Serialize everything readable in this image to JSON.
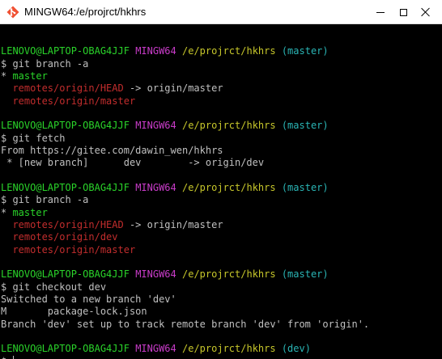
{
  "window": {
    "title": "MINGW64:/e/projrct/hkhrs"
  },
  "terminal": {
    "lines": [
      [],
      [
        {
          "t": "LENOVO@LAPTOP-OBAG4JJF",
          "c": "green"
        },
        {
          "t": " ",
          "c": "white"
        },
        {
          "t": "MINGW64",
          "c": "magenta"
        },
        {
          "t": " ",
          "c": "white"
        },
        {
          "t": "/e/projrct/hkhrs",
          "c": "yellow"
        },
        {
          "t": " ",
          "c": "white"
        },
        {
          "t": "(master)",
          "c": "cyan"
        }
      ],
      [
        {
          "t": "$ git branch -a",
          "c": "white"
        }
      ],
      [
        {
          "t": "* ",
          "c": "white"
        },
        {
          "t": "master",
          "c": "green"
        }
      ],
      [
        {
          "t": "  ",
          "c": "white"
        },
        {
          "t": "remotes/origin/HEAD",
          "c": "red"
        },
        {
          "t": " -> origin/master",
          "c": "white"
        }
      ],
      [
        {
          "t": "  ",
          "c": "white"
        },
        {
          "t": "remotes/origin/master",
          "c": "red"
        }
      ],
      [],
      [
        {
          "t": "LENOVO@LAPTOP-OBAG4JJF",
          "c": "green"
        },
        {
          "t": " ",
          "c": "white"
        },
        {
          "t": "MINGW64",
          "c": "magenta"
        },
        {
          "t": " ",
          "c": "white"
        },
        {
          "t": "/e/projrct/hkhrs",
          "c": "yellow"
        },
        {
          "t": " ",
          "c": "white"
        },
        {
          "t": "(master)",
          "c": "cyan"
        }
      ],
      [
        {
          "t": "$ git fetch",
          "c": "white"
        }
      ],
      [
        {
          "t": "From https://gitee.com/dawin_wen/hkhrs",
          "c": "white"
        }
      ],
      [
        {
          "t": " * [new branch]      dev        -> origin/dev",
          "c": "white"
        }
      ],
      [],
      [
        {
          "t": "LENOVO@LAPTOP-OBAG4JJF",
          "c": "green"
        },
        {
          "t": " ",
          "c": "white"
        },
        {
          "t": "MINGW64",
          "c": "magenta"
        },
        {
          "t": " ",
          "c": "white"
        },
        {
          "t": "/e/projrct/hkhrs",
          "c": "yellow"
        },
        {
          "t": " ",
          "c": "white"
        },
        {
          "t": "(master)",
          "c": "cyan"
        }
      ],
      [
        {
          "t": "$ git branch -a",
          "c": "white"
        }
      ],
      [
        {
          "t": "* ",
          "c": "white"
        },
        {
          "t": "master",
          "c": "green"
        }
      ],
      [
        {
          "t": "  ",
          "c": "white"
        },
        {
          "t": "remotes/origin/HEAD",
          "c": "red"
        },
        {
          "t": " -> origin/master",
          "c": "white"
        }
      ],
      [
        {
          "t": "  ",
          "c": "white"
        },
        {
          "t": "remotes/origin/dev",
          "c": "red"
        }
      ],
      [
        {
          "t": "  ",
          "c": "white"
        },
        {
          "t": "remotes/origin/master",
          "c": "red"
        }
      ],
      [],
      [
        {
          "t": "LENOVO@LAPTOP-OBAG4JJF",
          "c": "green"
        },
        {
          "t": " ",
          "c": "white"
        },
        {
          "t": "MINGW64",
          "c": "magenta"
        },
        {
          "t": " ",
          "c": "white"
        },
        {
          "t": "/e/projrct/hkhrs",
          "c": "yellow"
        },
        {
          "t": " ",
          "c": "white"
        },
        {
          "t": "(master)",
          "c": "cyan"
        }
      ],
      [
        {
          "t": "$ git checkout dev",
          "c": "white"
        }
      ],
      [
        {
          "t": "Switched to a new branch 'dev'",
          "c": "white"
        }
      ],
      [
        {
          "t": "M       package-lock.json",
          "c": "white"
        }
      ],
      [
        {
          "t": "Branch 'dev' set up to track remote branch 'dev' from 'origin'.",
          "c": "white"
        }
      ],
      [],
      [
        {
          "t": "LENOVO@LAPTOP-OBAG4JJF",
          "c": "green"
        },
        {
          "t": " ",
          "c": "white"
        },
        {
          "t": "MINGW64",
          "c": "magenta"
        },
        {
          "t": " ",
          "c": "white"
        },
        {
          "t": "/e/projrct/hkhrs",
          "c": "yellow"
        },
        {
          "t": " ",
          "c": "white"
        },
        {
          "t": "(dev)",
          "c": "cyan"
        }
      ]
    ],
    "prompt": "$ "
  },
  "colors": {
    "background": "#000000",
    "text": "#c0c0c0",
    "green": "#2ad42a",
    "magenta": "#c93cc9",
    "yellow": "#c7c72b",
    "cyan": "#2ab5b5",
    "red": "#c22d2d"
  },
  "icons": {
    "app": "git-bash-diamond-icon",
    "minimize": "minimize-icon",
    "maximize": "maximize-icon",
    "close": "close-icon"
  }
}
